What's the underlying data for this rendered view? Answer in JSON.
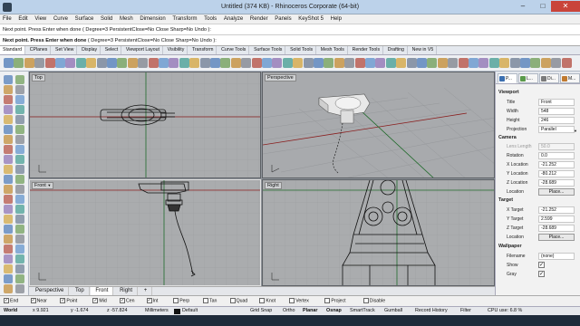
{
  "window": {
    "title": "Untitled (374 KB) - Rhinoceros Corporate (64-bit)",
    "minimize": "–",
    "maximize": "□",
    "close": "✕"
  },
  "menu": [
    "File",
    "Edit",
    "View",
    "Curve",
    "Surface",
    "Solid",
    "Mesh",
    "Dimension",
    "Transform",
    "Tools",
    "Analyze",
    "Render",
    "Panels",
    "KeyShot 5",
    "Help"
  ],
  "command": {
    "history": "Next point. Press Enter when done ( Degree=3  PersistentClose=No  Close  Sharp=No  Undo ):",
    "prompt": "Next point. Press Enter when done",
    "options": "( Degree=3  PersistentClose=No  Close  Sharp=No  Undo ):"
  },
  "toolbar_tabs": [
    "Standard",
    "CPlanes",
    "Set View",
    "Display",
    "Select",
    "Viewport Layout",
    "Visibility",
    "Transform",
    "Curve Tools",
    "Surface Tools",
    "Solid Tools",
    "Mesh Tools",
    "Render Tools",
    "Drafting",
    "New in V5"
  ],
  "viewports": {
    "top": "Top",
    "perspective": "Perspective",
    "front": "Front",
    "right": "Right",
    "dropdown": "▼"
  },
  "viewport_tabs": [
    "Perspective",
    "Top",
    "Front",
    "Right"
  ],
  "viewport_tabs_add": "+",
  "panel": {
    "tab_labels": [
      "P...",
      "L...",
      "Di...",
      "M..."
    ],
    "viewport": {
      "heading": "Viewport",
      "title_label": "Title",
      "title_value": "Front",
      "width_label": "Width",
      "width_value": "548",
      "height_label": "Height",
      "height_value": "246",
      "projection_label": "Projection",
      "projection_value": "Parallel"
    },
    "camera": {
      "heading": "Camera",
      "lens_label": "Lens Length",
      "lens_value": "50.0",
      "rotation_label": "Rotation",
      "rotation_value": "0.0",
      "xloc_label": "X Location",
      "xloc_value": "-21.252",
      "yloc_label": "Y Location",
      "yloc_value": "-80.212",
      "zloc_label": "Z Location",
      "zloc_value": "-28.689",
      "location_label": "Location",
      "place_button": "Place..."
    },
    "target": {
      "heading": "Target",
      "xt_label": "X Target",
      "xt_value": "-21.252",
      "yt_label": "Y Target",
      "yt_value": "2.599",
      "zt_label": "Z Target",
      "zt_value": "-28.689",
      "location_label": "Location",
      "place_button": "Place..."
    },
    "wallpaper": {
      "heading": "Wallpaper",
      "filename_label": "Filename",
      "filename_value": "(none)",
      "show_label": "Show",
      "show_checked": "✓",
      "gray_label": "Gray",
      "gray_checked": "✓"
    }
  },
  "osnaps": [
    {
      "label": "End",
      "checked": true
    },
    {
      "label": "Near",
      "checked": true
    },
    {
      "label": "Point",
      "checked": true
    },
    {
      "label": "Mid",
      "checked": true
    },
    {
      "label": "Cen",
      "checked": true
    },
    {
      "label": "Int",
      "checked": true
    },
    {
      "label": "Perp",
      "checked": false
    },
    {
      "label": "Tan",
      "checked": false
    },
    {
      "label": "Quad",
      "checked": false
    },
    {
      "label": "Knot",
      "checked": false
    },
    {
      "label": "Vertex",
      "checked": false
    },
    {
      "label": "Project",
      "checked": false
    },
    {
      "label": "Disable",
      "checked": false
    }
  ],
  "status": {
    "cplane": "World",
    "x": "x 9.921",
    "y": "y -1.674",
    "z": "z -57.824",
    "units": "Millimeters",
    "layer": "Default",
    "grid_snap": "Grid Snap",
    "ortho": "Ortho",
    "planar": "Planar",
    "osnap": "Osnap",
    "smarttrack": "SmartTrack",
    "gumball": "Gumball",
    "record_history": "Record History",
    "filter": "Filter",
    "cpu": "CPU use: 6.8 %"
  },
  "colors": {
    "x_axis": "#c0392b",
    "y_axis": "#2e8b3a",
    "grid": "#9a9c9e",
    "accent": "#1f6fc1"
  }
}
